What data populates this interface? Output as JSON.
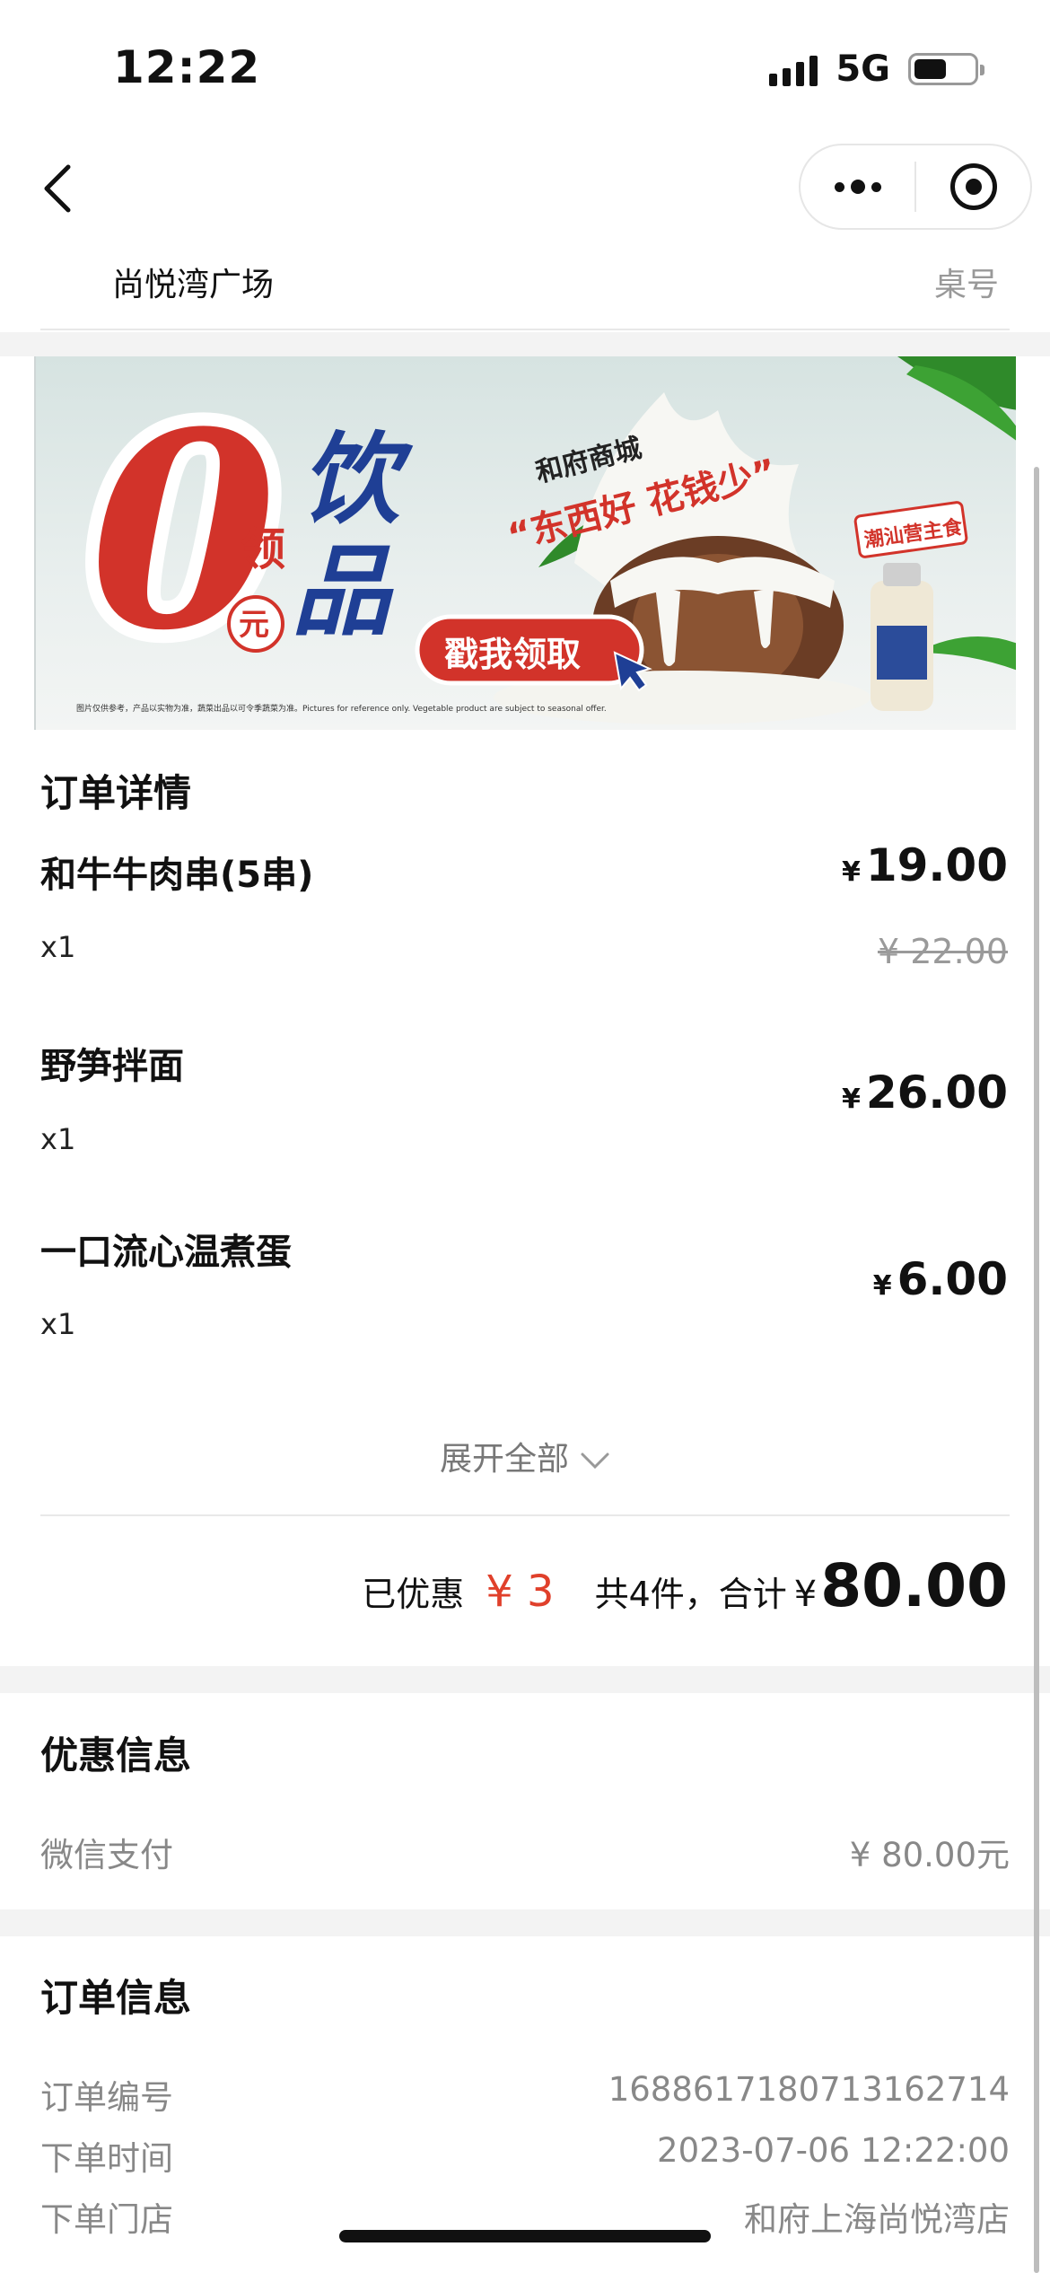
{
  "status_bar": {
    "time": "12:22",
    "network": "5G",
    "battery_level_fraction": 0.55
  },
  "nav": {
    "back_icon": "chevron-left-icon",
    "more_icon": "more-dots-icon",
    "close_icon": "target-circle-icon"
  },
  "store": {
    "name": "尚悦湾广场",
    "table_label": "桌号"
  },
  "banner": {
    "zero": "0",
    "yuan": "元",
    "ling": "领",
    "drink_line1": "饮",
    "drink_line2": "品",
    "mall": "和府商城",
    "slogan": "“东西好 花钱少”",
    "cta": "戳我领取",
    "stamp": "潮汕营主食",
    "disclaimer": "图片仅供参考，产品以实物为准，蔬菜出品以可令季蔬菜为准。Pictures for reference only. Vegetable product are subject to seasonal offer."
  },
  "order": {
    "title": "订单详情",
    "currency": "¥",
    "items": [
      {
        "name": "和牛牛肉串(5串)",
        "qty": "x1",
        "price": "19.00",
        "original_price": "¥ 22.00"
      },
      {
        "name": "野笋拌面",
        "qty": "x1",
        "price": "26.00"
      },
      {
        "name": "一口流心温煮蛋",
        "qty": "x1",
        "price": "6.00"
      }
    ],
    "expand_label": "展开全部",
    "summary": {
      "discount_label": "已优惠",
      "discount_value": "¥ 3",
      "count_label": "共4件，合计",
      "currency": "¥",
      "total": "80.00"
    }
  },
  "discount_info": {
    "title": "优惠信息",
    "rows": [
      {
        "label": "微信支付",
        "value": "¥ 80.00元"
      }
    ]
  },
  "order_info": {
    "title": "订单信息",
    "rows": [
      {
        "label": "订单编号",
        "value": "1688617180713162714"
      },
      {
        "label": "下单时间",
        "value": "2023-07-06 12:22:00"
      },
      {
        "label": "下单门店",
        "value": "和府上海尚悦湾店"
      }
    ]
  },
  "colors": {
    "accent_red": "#e0402b",
    "banner_red": "#d2332a",
    "banner_blue": "#1f3f95"
  }
}
